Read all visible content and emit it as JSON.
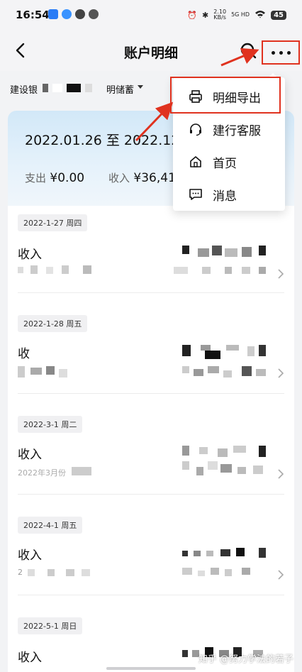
{
  "status_bar": {
    "time": "16:54",
    "net_speed_value": "2.10",
    "net_speed_unit": "KB/s",
    "net_type": "5G HD",
    "battery": "45"
  },
  "header": {
    "title": "账户明细"
  },
  "account": {
    "prefix": "建设银",
    "suffix": "明储蓄"
  },
  "summary": {
    "date_range": "2022.01.26 至 2022.12.31",
    "expense_label": "支出",
    "expense_value": "¥0.00",
    "income_label": "收入",
    "income_value": "¥36,41"
  },
  "transactions": [
    {
      "date": "2022-1-27 周四",
      "title": "收入",
      "sub": ""
    },
    {
      "date": "2022-1-28 周五",
      "title": "收",
      "sub": ""
    },
    {
      "date": "2022-3-1 周二",
      "title": "收入",
      "sub": "2022年3月份"
    },
    {
      "date": "2022-4-1 周五",
      "title": "收入",
      "sub": "2"
    },
    {
      "date": "2022-5-1 周日",
      "title": "收入",
      "sub": ""
    }
  ],
  "menu": {
    "items": [
      {
        "label": "明细导出",
        "icon": "printer-icon"
      },
      {
        "label": "建行客服",
        "icon": "headset-icon"
      },
      {
        "label": "首页",
        "icon": "home-icon"
      },
      {
        "label": "消息",
        "icon": "message-icon"
      }
    ]
  },
  "watermark": "知乎 @努力学法的若子",
  "colors": {
    "annotation_red": "#e0321f",
    "card_gradient_top": "#d2e8f8"
  }
}
